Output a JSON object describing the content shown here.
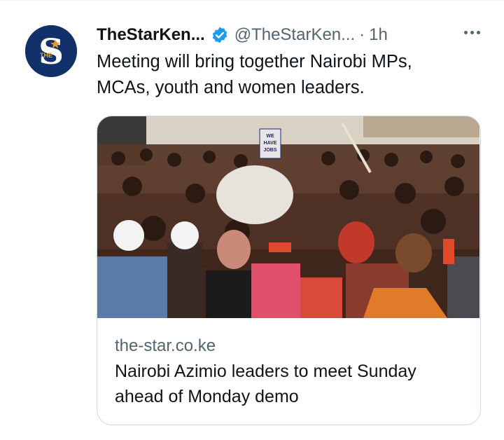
{
  "tweet": {
    "display_name": "TheStarKen...",
    "handle": "@TheStarKen...",
    "separator": "·",
    "time": "1h",
    "text_line1": "Meeting will bring together Nairobi MPs,",
    "text_line2": "MCAs, youth and women leaders.",
    "verified_color": "#1d9bf0",
    "avatar": {
      "letter": "S",
      "small_text": "THE"
    },
    "more_icon": "more-horizontal-icon"
  },
  "card": {
    "domain": "the-star.co.ke",
    "title_line1": "Nairobi Azimio leaders to meet Sunday",
    "title_line2": "ahead of Monday demo",
    "image_sign_text": [
      "WE",
      "HAVE",
      "JOBS"
    ]
  }
}
